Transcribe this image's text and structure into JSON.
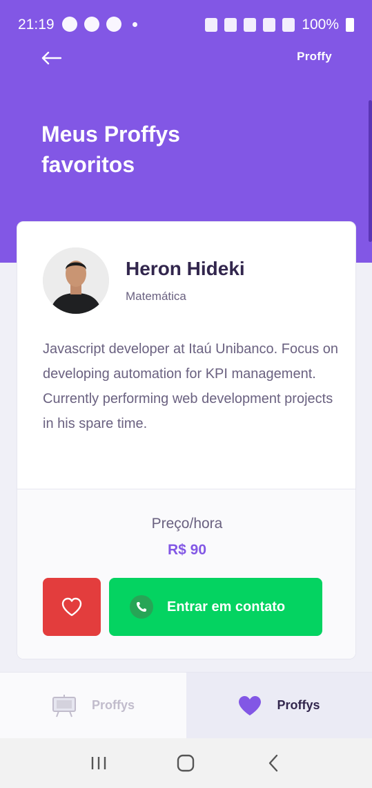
{
  "status_bar": {
    "time": "21:19",
    "battery": "100%",
    "left_icons": [
      "app-icon",
      "app-icon",
      "app-icon",
      "notification-dot-icon"
    ],
    "right_icons": [
      "alarm-icon",
      "bluetooth-icon",
      "mute-icon",
      "4g-icon",
      "signal-icon",
      "battery-icon"
    ]
  },
  "header": {
    "logo": "Proffy",
    "title_line1": "Meus Proffys",
    "title_line2": "favoritos",
    "back_icon": "arrow-left-icon",
    "background": "#8257E5"
  },
  "teacher": {
    "name": "Heron Hideki",
    "subject": "Matemática",
    "bio": "Javascript developer at Itaú Unibanco. Focus on developing automation for KPI management. Currently performing web development projects in his spare time.",
    "price_label": "Preço/hora",
    "price_value": "R$ 90",
    "contact_label": "Entrar em contato"
  },
  "tabs": [
    {
      "label": "Proffys",
      "icon": "easel-icon",
      "active": false
    },
    {
      "label": "Proffys",
      "icon": "heart-icon",
      "active": true
    }
  ],
  "colors": {
    "primary": "#8257E5",
    "danger": "#E33D3D",
    "success": "#04D361",
    "title": "#32264D",
    "text": "#6A6180"
  }
}
